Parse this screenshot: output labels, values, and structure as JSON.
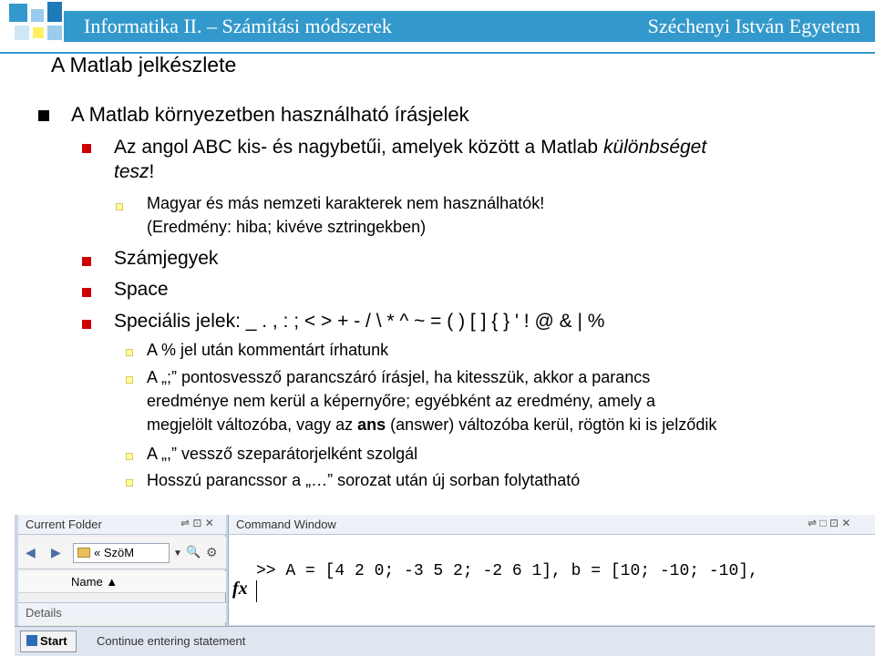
{
  "header": {
    "course": "Informatika II. – Számítási módszerek",
    "university": "Széchenyi István Egyetem"
  },
  "slide": {
    "title": "A Matlab jelkészlete",
    "bullets": {
      "main": "A Matlab környezetben használható írásjelek",
      "case_1": "Az angol ABC kis- és nagybetűi, amelyek között a Matlab ",
      "case_em": "különbséget",
      "case_2a": "tesz",
      "case_2b": "!",
      "magyar_1": "Magyar és más nemzeti karakterek nem használhatók!",
      "magyar_2": "(Eredmény: hiba; kivéve sztringekben)",
      "digits": "Számjegyek",
      "space": "Space",
      "special": "Speciális jelek: _ . , : ; < > + - / \\ * ^ ~ = ( ) [ ] { } ' ! @ & | %",
      "percent": "A % jel után kommentárt írhatunk",
      "semi_1": "A „;” pontosvessző parancszáró írásjel, ha kitesszük, akkor a parancs",
      "semi_2": "eredménye nem kerül a képernyőre; egyébként az eredmény, amely a",
      "semi_3a": "megjelölt változóba, vagy az ",
      "semi_3b": "ans",
      "semi_3c": " (answer) változóba kerül, rögtön ki is jelződik",
      "comma": "A „,” vessző szeparátorjelként szolgál",
      "cont": "Hosszú parancssor a „…” sorozat után új sorban folytatható"
    }
  },
  "matlab": {
    "current_folder_title": "Current Folder",
    "path": "« SzöM",
    "name_header": "Name ▲",
    "details": "Details",
    "command_window_title": "Command Window",
    "command": ">> A = [4 2 0; -3 5 2; -2 6 1], b = [10; -10; -10],",
    "fx": "fx",
    "start": "Start",
    "status": "Continue entering statement",
    "pane_controls": "⇌ ⊡ ✕",
    "cmd_controls": "⇌ □ ⊡ ✕",
    "back": "◀",
    "forward": "▶",
    "dropdown": "▼",
    "search": "🔍",
    "gear": "⚙"
  }
}
